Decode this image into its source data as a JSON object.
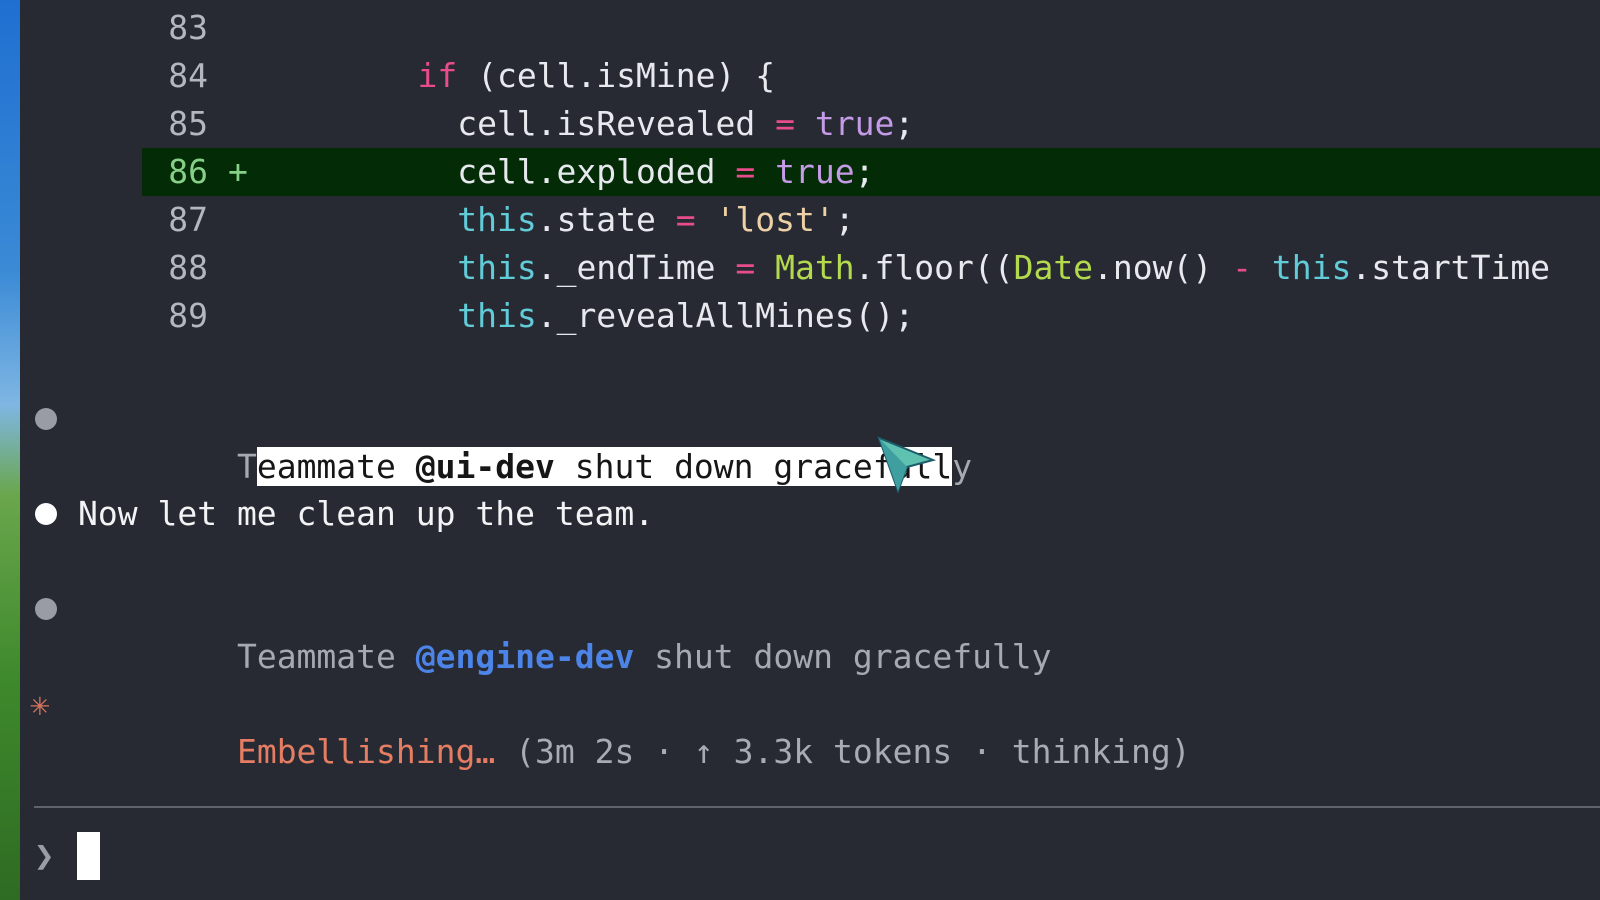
{
  "code_lines": [
    {
      "number": "83",
      "marker": "",
      "tokens": []
    },
    {
      "number": "84",
      "marker": "",
      "tokens": [
        {
          "text": "    "
        },
        {
          "text": "if",
          "style": "keyword"
        },
        {
          "text": " (cell.isMine) {"
        }
      ]
    },
    {
      "number": "85",
      "marker": "",
      "tokens": [
        {
          "text": "      cell.isRevealed "
        },
        {
          "text": "=",
          "style": "operator"
        },
        {
          "text": " "
        },
        {
          "text": "true",
          "style": "boolean"
        },
        {
          "text": ";"
        }
      ]
    },
    {
      "number": "86",
      "marker": "+",
      "tokens": [
        {
          "text": "      cell.exploded "
        },
        {
          "text": "=",
          "style": "operator"
        },
        {
          "text": " "
        },
        {
          "text": "true",
          "style": "boolean"
        },
        {
          "text": ";"
        }
      ]
    },
    {
      "number": "87",
      "marker": "",
      "tokens": [
        {
          "text": "      "
        },
        {
          "text": "this",
          "style": "this"
        },
        {
          "text": ".state "
        },
        {
          "text": "=",
          "style": "operator"
        },
        {
          "text": " "
        },
        {
          "text": "'lost'",
          "style": "string"
        },
        {
          "text": ";"
        }
      ]
    },
    {
      "number": "88",
      "marker": "",
      "tokens": [
        {
          "text": "      "
        },
        {
          "text": "this",
          "style": "this"
        },
        {
          "text": "._endTime "
        },
        {
          "text": "=",
          "style": "operator"
        },
        {
          "text": " "
        },
        {
          "text": "Math",
          "style": "builtin"
        },
        {
          "text": ".floor(("
        },
        {
          "text": "Date",
          "style": "builtin"
        },
        {
          "text": ".now() "
        },
        {
          "text": "-",
          "style": "operator"
        },
        {
          "text": " "
        },
        {
          "text": "this",
          "style": "this"
        },
        {
          "text": ".startTime"
        }
      ]
    },
    {
      "number": "89",
      "marker": "",
      "tokens": [
        {
          "text": "      "
        },
        {
          "text": "this",
          "style": "this"
        },
        {
          "text": "._revealAllMines();"
        }
      ]
    }
  ],
  "messages": {
    "ui_dev": {
      "pre_highlight": "T",
      "highlight_prefix": "eammate ",
      "handle": "@ui-dev",
      "highlight_suffix": " shut down gracefull",
      "post_highlight": "y"
    },
    "cleanup": {
      "text": "Now let me clean up the team."
    },
    "engine_dev": {
      "prefix": "Teammate ",
      "handle": "@engine-dev",
      "suffix": " shut down gracefully"
    }
  },
  "status": {
    "icon": "✳",
    "action": "Embellishing…",
    "details": " (3m 2s · ↑ 3.3k tokens · thinking)"
  },
  "prompt": {
    "symbol": "❯",
    "value": ""
  },
  "colors": {
    "background": "#272a33",
    "added_line": "#032c06",
    "keyword": "#e94c8c",
    "this": "#61cbd8",
    "boolean": "#c59ae6",
    "string": "#eed0a6",
    "builtin": "#b3d94c",
    "handle_blue": "#4c84e8",
    "status_orange": "#e57d63",
    "pointer": "#5fc1b0"
  }
}
